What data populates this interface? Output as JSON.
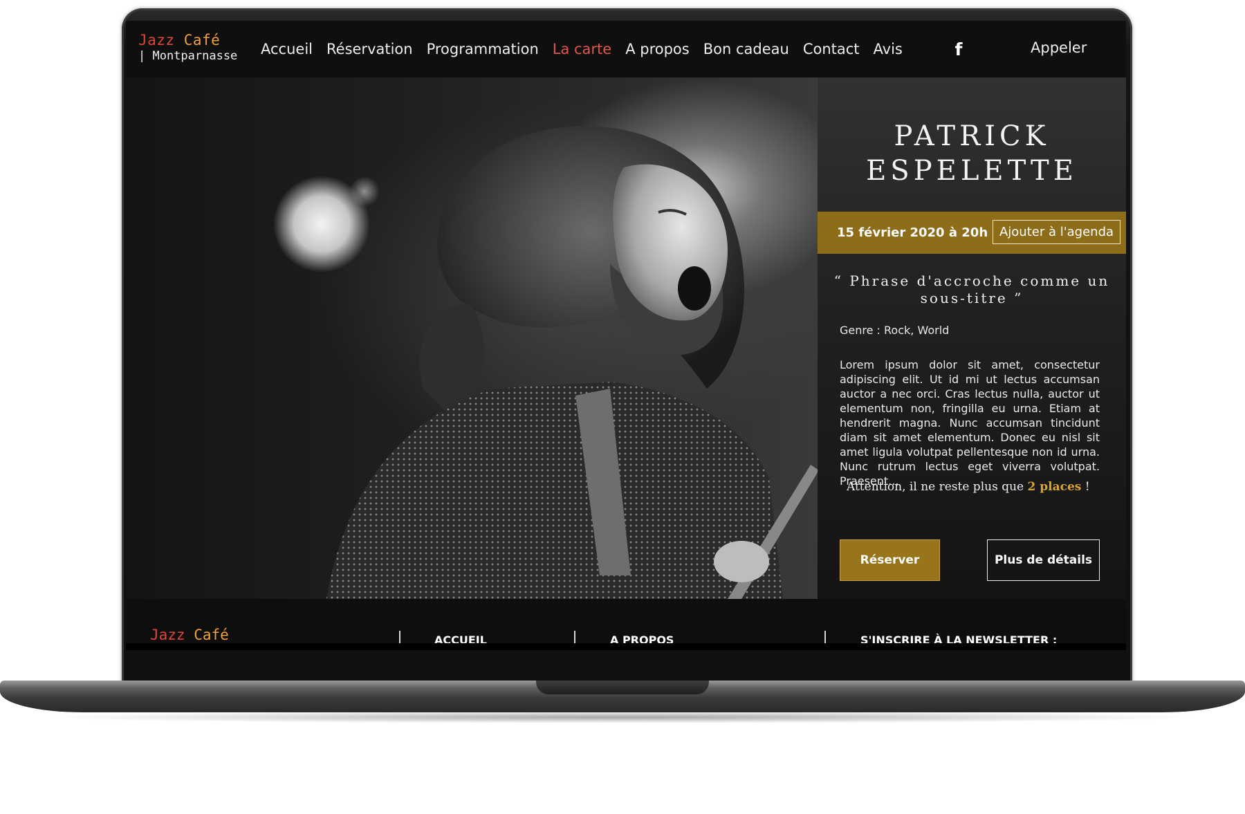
{
  "brand": {
    "jazz": "Jazz",
    "cafe": "Café",
    "location": "| Montparnasse"
  },
  "nav": {
    "links": [
      "Accueil",
      "Réservation",
      "Programmation",
      "La carte",
      "A propos",
      "Bon cadeau",
      "Contact",
      "Avis"
    ],
    "active_link": "La carte",
    "social_icon": "facebook-icon",
    "call_label": "Appeler"
  },
  "event": {
    "artist_line1": "PATRICK",
    "artist_line2": "ESPELETTE",
    "date": "15 février 2020 à 20h",
    "add_to_calendar": "Ajouter à l'agenda",
    "tagline": "“ Phrase d'accroche comme un sous-titre ”",
    "genre": "Genre : Rock, World",
    "description": "Lorem ipsum dolor sit amet, consectetur adipiscing elit. Ut id mi ut lectus accumsan auctor a nec orci. Cras lectus nulla, auctor ut elementum non, fringilla eu urna. Etiam at hendrerit magna. Nunc accumsan tincidunt diam sit amet elementum. Donec eu nisl sit amet ligula volutpat pellentesque non id urna. Nunc rutrum lectus eget viverra volutpat. Praesent...",
    "warning_prefix": "Attention, il ne reste plus que",
    "places": "2 places",
    "warning_suffix": "!",
    "reserve_label": "Réserver",
    "details_label": "Plus de détails"
  },
  "footer": {
    "brand_jazz": "Jazz",
    "brand_cafe": "Café",
    "headings": [
      "ACCUEIL",
      "A PROPOS",
      "S'INSCRIRE À LA NEWSLETTER :"
    ]
  },
  "colors": {
    "accent_gold": "#8d6d19",
    "active_nav": "#e0554c",
    "brand_red": "#e0443a",
    "brand_orange": "#f0a13a"
  }
}
